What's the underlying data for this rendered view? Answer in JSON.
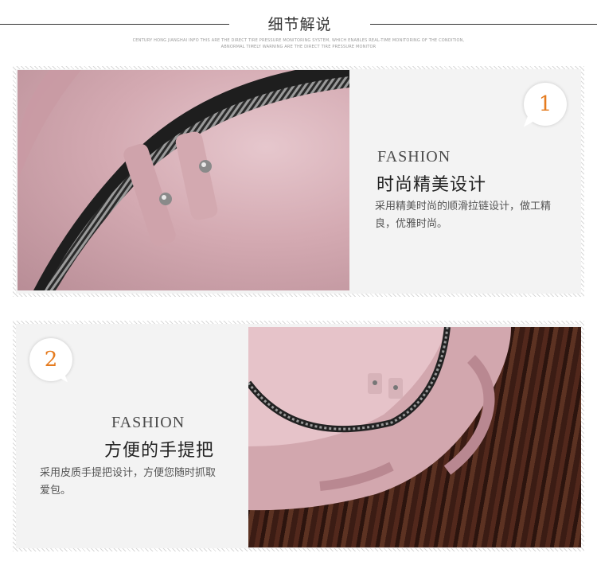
{
  "header": {
    "title": "细节解说",
    "subtitle_line1": "CENTURY HONG JIANGHAI INFO THIS ARE THE DIRECT TIRE PRESSURE MONITORING SYSTEM, WHICH ENABLES REAL-TIME MONITORING OF THE CONDITION,",
    "subtitle_line2": "ABNORMAL TIMELY WARNING ARE THE DIRECT TIRE PRESSURE MONITOR"
  },
  "sections": [
    {
      "number": "1",
      "en": "FASHION",
      "title": "时尚精美设计",
      "desc": "采用精美时尚的顺滑拉链设计，做工精良，优雅时尚。"
    },
    {
      "number": "2",
      "en": "FASHION",
      "title": "方便的手提把",
      "desc": "采用皮质手提把设计，方便您随时抓取爱包。"
    }
  ],
  "colors": {
    "accent_number": "#e57b1e",
    "bag_pink": "#d4aab2",
    "wood_floor": "#3b1c14"
  }
}
